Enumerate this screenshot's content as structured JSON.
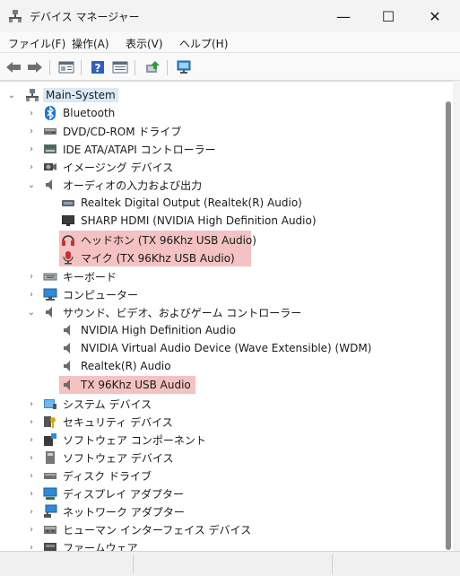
{
  "window": {
    "title": "デバイス マネージャー",
    "minimize": "—",
    "maximize": "☐",
    "close": "✕"
  },
  "menu": [
    "ファイル(F)",
    "操作(A)",
    "表示(V)",
    "ヘルプ(H)"
  ],
  "toolbar": [
    "back-icon",
    "forward-icon",
    "properties-icon",
    "help-icon",
    "view-icon",
    "update-driver-icon",
    "scan-hardware-icon"
  ],
  "tree": {
    "root": "Main-System",
    "nodes": [
      "Bluetooth",
      "DVD/CD-ROM ドライブ",
      "IDE ATA/ATAPI コントローラー",
      "イメージング デバイス",
      "オーディオの入力および出力",
      "Realtek Digital Output (Realtek(R) Audio)",
      "SHARP HDMI (NVIDIA High Definition Audio)",
      "ヘッドホン (TX 96Khz USB Audio)",
      "マイク (TX 96Khz USB Audio)",
      "キーボード",
      "コンピューター",
      "サウンド、ビデオ、およびゲーム コントローラー",
      "NVIDIA High Definition Audio",
      "NVIDIA Virtual Audio Device (Wave Extensible) (WDM)",
      "Realtek(R) Audio",
      "TX 96Khz USB Audio",
      "システム デバイス",
      "セキュリティ デバイス",
      "ソフトウェア コンポーネント",
      "ソフトウェア デバイス",
      "ディスク ドライブ",
      "ディスプレイ アダプター",
      "ネットワーク アダプター",
      "ヒューマン インターフェイス デバイス",
      "ファームウェア"
    ]
  },
  "colors": {
    "highlight": "#f4c2c2",
    "root_selection": "#dbe9f7",
    "scroll_thumb": "#8b8b8b"
  }
}
